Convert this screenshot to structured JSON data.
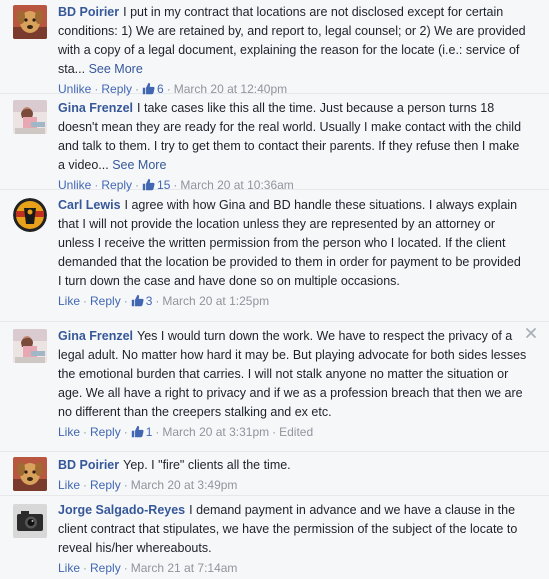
{
  "comments": [
    {
      "author": "BD Poirier",
      "text": "I put in my contract that locations are not disclosed except for certain conditions: 1) We are retained by, and report to, legal counsel; or 2) We are provided with a copy of a legal document, explaining the reason for the locate (i.e.: service of sta...",
      "see_more": "See More",
      "action": "Unlike",
      "reply": "Reply",
      "likes": "6",
      "timestamp": "March 20 at 12:40pm",
      "avatar_icon": "dog-avatar"
    },
    {
      "author": "Gina Frenzel",
      "text": "I take cases like this all the time. Just because a person turns 18 doesn't mean they are ready for the real world. Usually I make contact with the child and talk to them. I try to get them to contact their parents. If they refuse then I make a video...",
      "see_more": "See More",
      "action": "Unlike",
      "reply": "Reply",
      "likes": "15",
      "timestamp": "March 20 at 10:36am",
      "avatar_icon": "person-avatar"
    },
    {
      "author": "Carl Lewis",
      "text": "I agree with how Gina and BD handle these situations. I always explain that I will not provide the location unless they are represented by an attorney or unless I receive the written permission from the person who I located. If the client demanded that the location be provided to them in order for payment to be provided I turn down the case and have done so on multiple occasions.",
      "action": "Like",
      "reply": "Reply",
      "likes": "3",
      "timestamp": "March 20 at 1:25pm",
      "avatar_icon": "badge-logo-avatar"
    },
    {
      "author": "Gina Frenzel",
      "text": "Yes I would turn down the work. We have to respect the privacy of a legal adult. No matter how hard it may be. But playing advocate for both sides lesses the emotional burden that carries. I will not stalk anyone no matter the situation or age. We all have a right to privacy and if we as a profession breach that then we are no different than the creepers stalking and ex etc.",
      "action": "Like",
      "reply": "Reply",
      "likes": "1",
      "timestamp": "March 20 at 3:31pm",
      "edited": "Edited",
      "avatar_icon": "person-avatar"
    },
    {
      "author": "BD Poirier",
      "text": "Yep. I \"fire\" clients all the time.",
      "action": "Like",
      "reply": "Reply",
      "timestamp": "March 20 at 3:49pm",
      "avatar_icon": "dog-avatar"
    },
    {
      "author": "Jorge Salgado-Reyes",
      "text": "I demand payment in advance and we have a clause in the client contract that stipulates, we have the permission of the subject of the locate to reveal his/her whereabouts.",
      "action": "Like",
      "reply": "Reply",
      "timestamp": "March 21 at 7:14am",
      "avatar_icon": "camera-avatar"
    }
  ],
  "colors": {
    "link": "#365899",
    "action": "#4267b2",
    "meta": "#90949c",
    "background": "#f6f7f9"
  }
}
